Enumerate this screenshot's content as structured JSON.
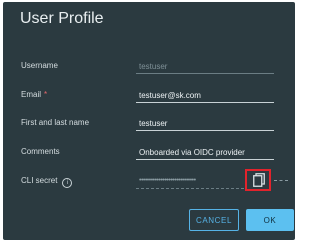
{
  "dialog": {
    "title": "User Profile"
  },
  "fields": {
    "username": {
      "label": "Username",
      "value": "testuser"
    },
    "email": {
      "label": "Email",
      "required_marker": "*",
      "value": "testuser@sk.com"
    },
    "full_name": {
      "label": "First and last name",
      "value": "testuser"
    },
    "comments": {
      "label": "Comments",
      "value": "Onboarded via OIDC provider"
    },
    "cli_secret": {
      "label": "CLI secret",
      "info_glyph": "i",
      "masked_value": "•••••••••••••••••••••••••••••"
    }
  },
  "icons": {
    "info": "info-circle-icon",
    "copy": "copy-icon"
  },
  "buttons": {
    "cancel": "CANCEL",
    "ok": "OK"
  },
  "colors": {
    "dialog_background": "#2b3a40",
    "accent": "#5cc0f0",
    "highlight_box": "#e1232c",
    "required": "#e8686c"
  }
}
